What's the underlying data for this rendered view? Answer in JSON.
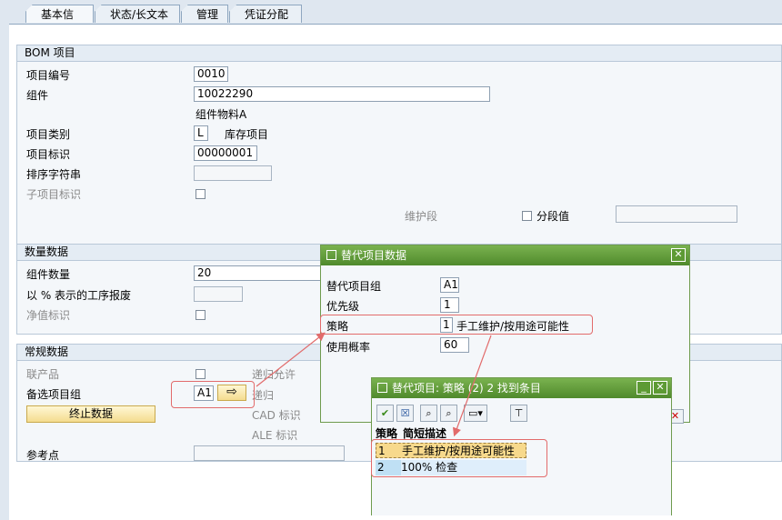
{
  "tabs": [
    "基本信息",
    "状态/长文本",
    "管理",
    "凭证分配"
  ],
  "bom": {
    "title": "BOM 项目",
    "item_no_label": "项目编号",
    "item_no": "0010",
    "component_label": "组件",
    "component": "10022290",
    "component_desc": "组件物料A",
    "item_cat_label": "项目类别",
    "item_cat": "L",
    "item_cat_desc": "库存项目",
    "item_id_label": "项目标识",
    "item_id": "00000001",
    "sort_label": "排序字符串",
    "sub_label": "子项目标识",
    "maint_label": "维护段",
    "segment_label": "分段值"
  },
  "qty": {
    "title": "数量数据",
    "qty_label": "组件数量",
    "qty": "20",
    "scrap_label": "以 % 表示的工序报废",
    "net_label": "净值标识"
  },
  "general": {
    "title": "常规数据",
    "coproduct_label": "联产品",
    "recursive_label": "递归允许",
    "alt_group_label": "备选项目组",
    "alt_group": "A1",
    "recursive2_label": "递归",
    "end_button": "终止数据",
    "cad_label": "CAD 标识",
    "ale_label": "ALE 标识",
    "ref_label": "参考点"
  },
  "alt_dialog": {
    "title": "替代项目数据",
    "group_label": "替代项目组",
    "group": "A1",
    "priority_label": "优先级",
    "priority": "1",
    "strategy_label": "策略",
    "strategy": "1",
    "strategy_desc": "手工维护/按用途可能性",
    "prob_label": "使用概率",
    "prob": "60"
  },
  "hit_dialog": {
    "title": "替代项目: 策略 (2)   2 找到条目",
    "col_strategy": "策略",
    "col_desc": "简短描述",
    "rows": [
      {
        "code": "1",
        "desc": "手工维护/按用途可能性"
      },
      {
        "code": "2",
        "desc": "100% 检查"
      }
    ]
  },
  "colors": {
    "title_green": "#4f8a2c",
    "highlight": "#e26b6b",
    "selected_row": "#f7d98c"
  }
}
